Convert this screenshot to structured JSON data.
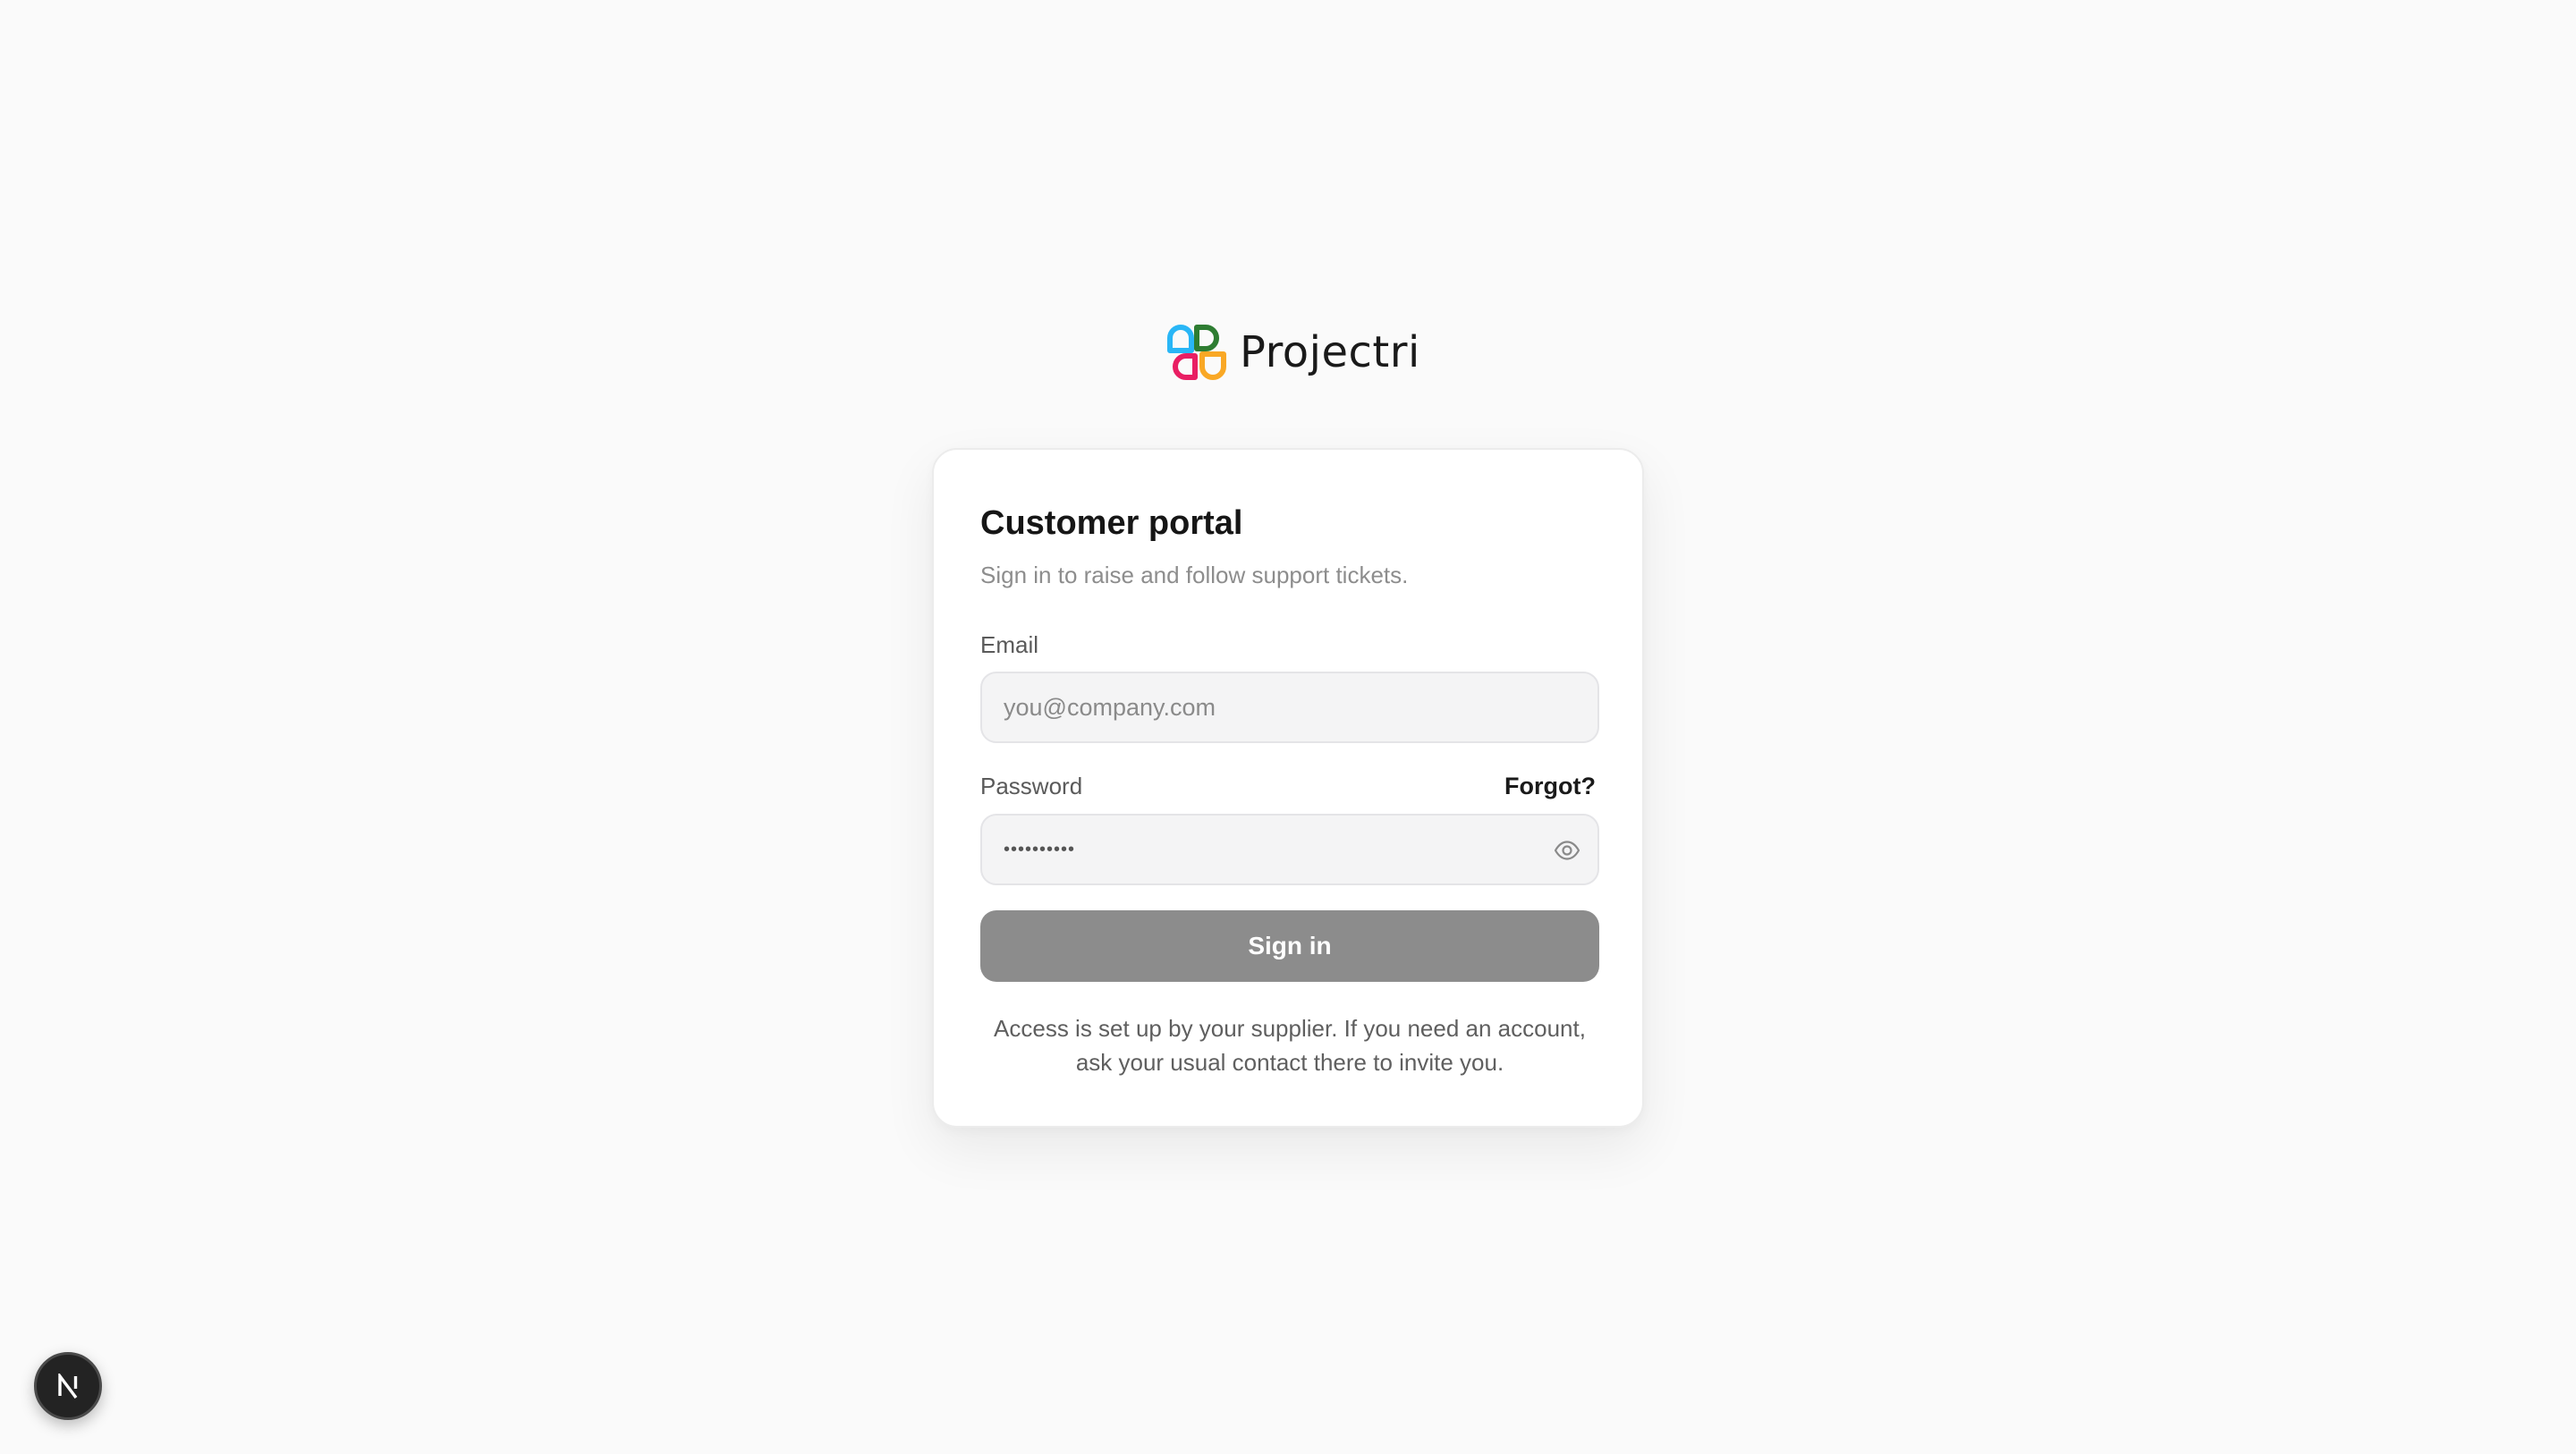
{
  "brand": {
    "name": "Projectri",
    "colors": [
      "#29b6f6",
      "#2e7d32",
      "#e91e63",
      "#f9a825"
    ]
  },
  "card": {
    "title": "Customer portal",
    "subtitle": "Sign in to raise and follow support tickets."
  },
  "form": {
    "email_label": "Email",
    "email_placeholder": "you@company.com",
    "email_value": "",
    "password_label": "Password",
    "password_value": "••••••••••",
    "forgot_label": "Forgot?",
    "password_toggle_icon": "eye-icon",
    "submit_label": "Sign in",
    "submit_color": "#8c8c8c"
  },
  "access_note": "Access is set up by your supplier. If you need an account, ask your usual contact there to invite you.",
  "dev_badge": {
    "icon": "nextjs-icon"
  }
}
